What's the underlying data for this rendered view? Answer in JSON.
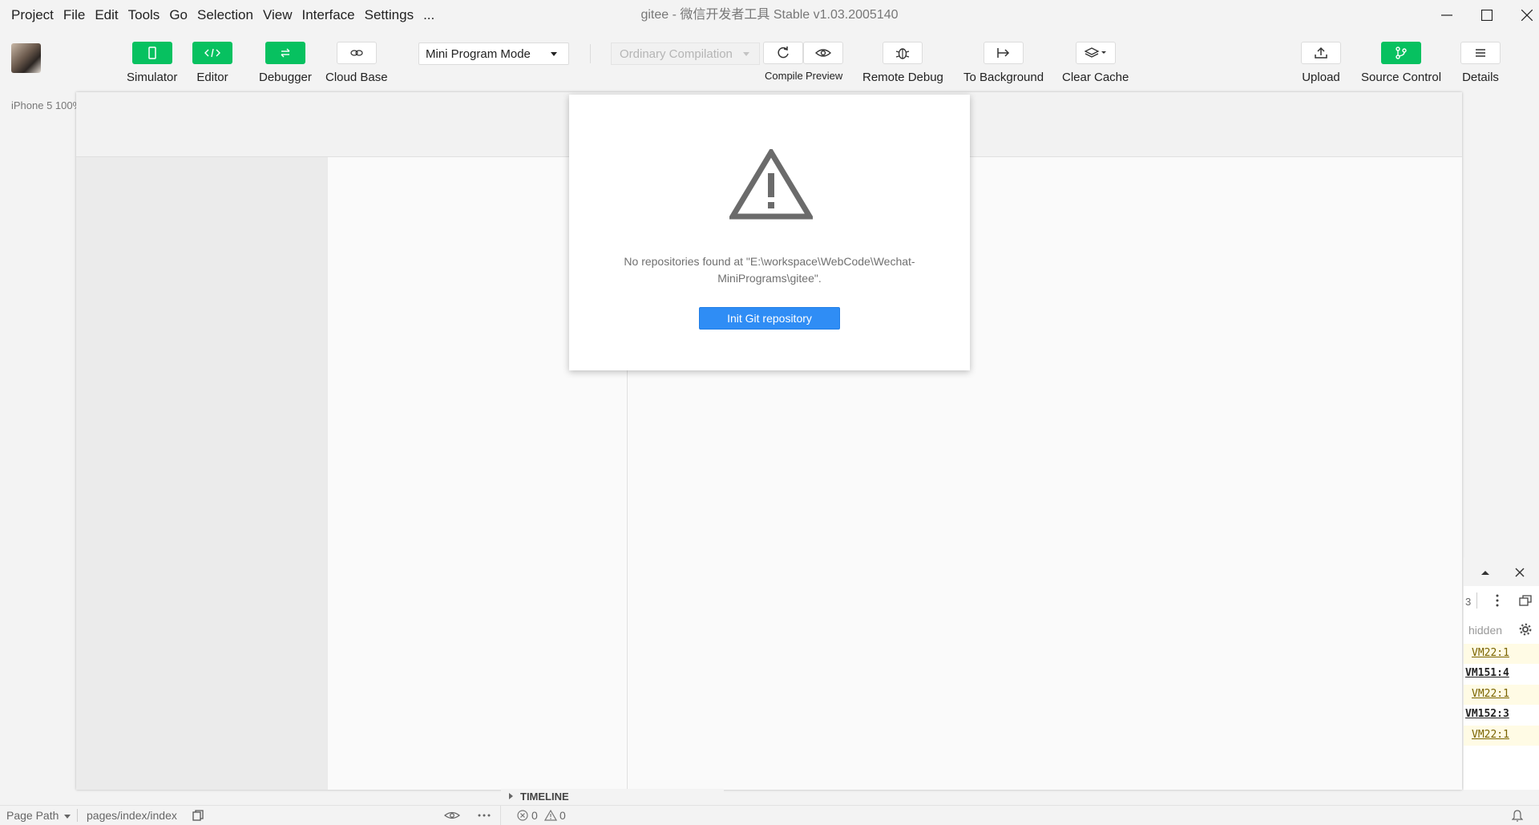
{
  "menu": [
    "Project",
    "File",
    "Edit",
    "Tools",
    "Go",
    "Selection",
    "View",
    "Interface",
    "Settings",
    "..."
  ],
  "window_title": "gitee - 微信开发者工具 Stable v1.03.2005140",
  "toolbar": {
    "simulator": "Simulator",
    "editor": "Editor",
    "debugger": "Debugger",
    "cloud_base": "Cloud Base",
    "mode": "Mini Program Mode",
    "compilation": "Ordinary Compilation",
    "compile": "Compile",
    "preview": "Preview",
    "remote_debug": "Remote Debug",
    "to_background": "To Background",
    "clear_cache": "Clear Cache",
    "upload": "Upload",
    "source_control": "Source Control",
    "details": "Details"
  },
  "simulator": {
    "device": "iPhone 5 100%"
  },
  "modal": {
    "message": "No repositories found at \"E:\\workspace\\WebCode\\Wechat-MiniPrograms\\gitee\".",
    "button": "Init Git repository"
  },
  "console": {
    "count": "3",
    "filter": "hidden",
    "rows": [
      {
        "text": "VM22:1",
        "type": "warn"
      },
      {
        "text": "VM151:4",
        "type": "plain"
      },
      {
        "text": "VM22:1",
        "type": "warn"
      },
      {
        "text": "VM152:3",
        "type": "plain"
      },
      {
        "text": "VM22:1",
        "type": "warn"
      }
    ]
  },
  "timeline": "TIMELINE",
  "statusbar": {
    "page_path_label": "Page Path",
    "page_path": "pages/index/index",
    "errors": "0",
    "warnings": "0"
  },
  "colors": {
    "accent_green": "#07c160",
    "primary_blue": "#2f8df5",
    "warn_bg": "#fffbe5"
  }
}
